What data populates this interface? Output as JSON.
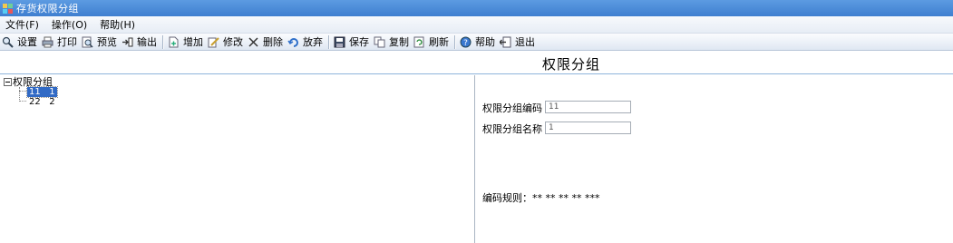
{
  "window": {
    "title": "存货权限分组"
  },
  "menu": [
    {
      "label": "文件(F)"
    },
    {
      "label": "操作(O)"
    },
    {
      "label": "帮助(H)"
    }
  ],
  "toolbar": {
    "settings": "设置",
    "print": "打印",
    "preview": "预览",
    "export": "输出",
    "add": "增加",
    "edit": "修改",
    "delete": "删除",
    "discard": "放弃",
    "save": "保存",
    "copy": "复制",
    "refresh": "刷新",
    "help": "帮助",
    "exit": "退出"
  },
  "page": {
    "heading": "权限分组"
  },
  "tree": {
    "root": "权限分组",
    "nodes": [
      {
        "code": "11",
        "name": "1",
        "selected": true
      },
      {
        "code": "22",
        "name": "2",
        "selected": false
      }
    ]
  },
  "form": {
    "code_label": "权限分组编码",
    "code_value": "11",
    "name_label": "权限分组名称",
    "name_value": "1",
    "rule_label": "编码规则：",
    "rule_value": "** ** ** ** ***"
  }
}
